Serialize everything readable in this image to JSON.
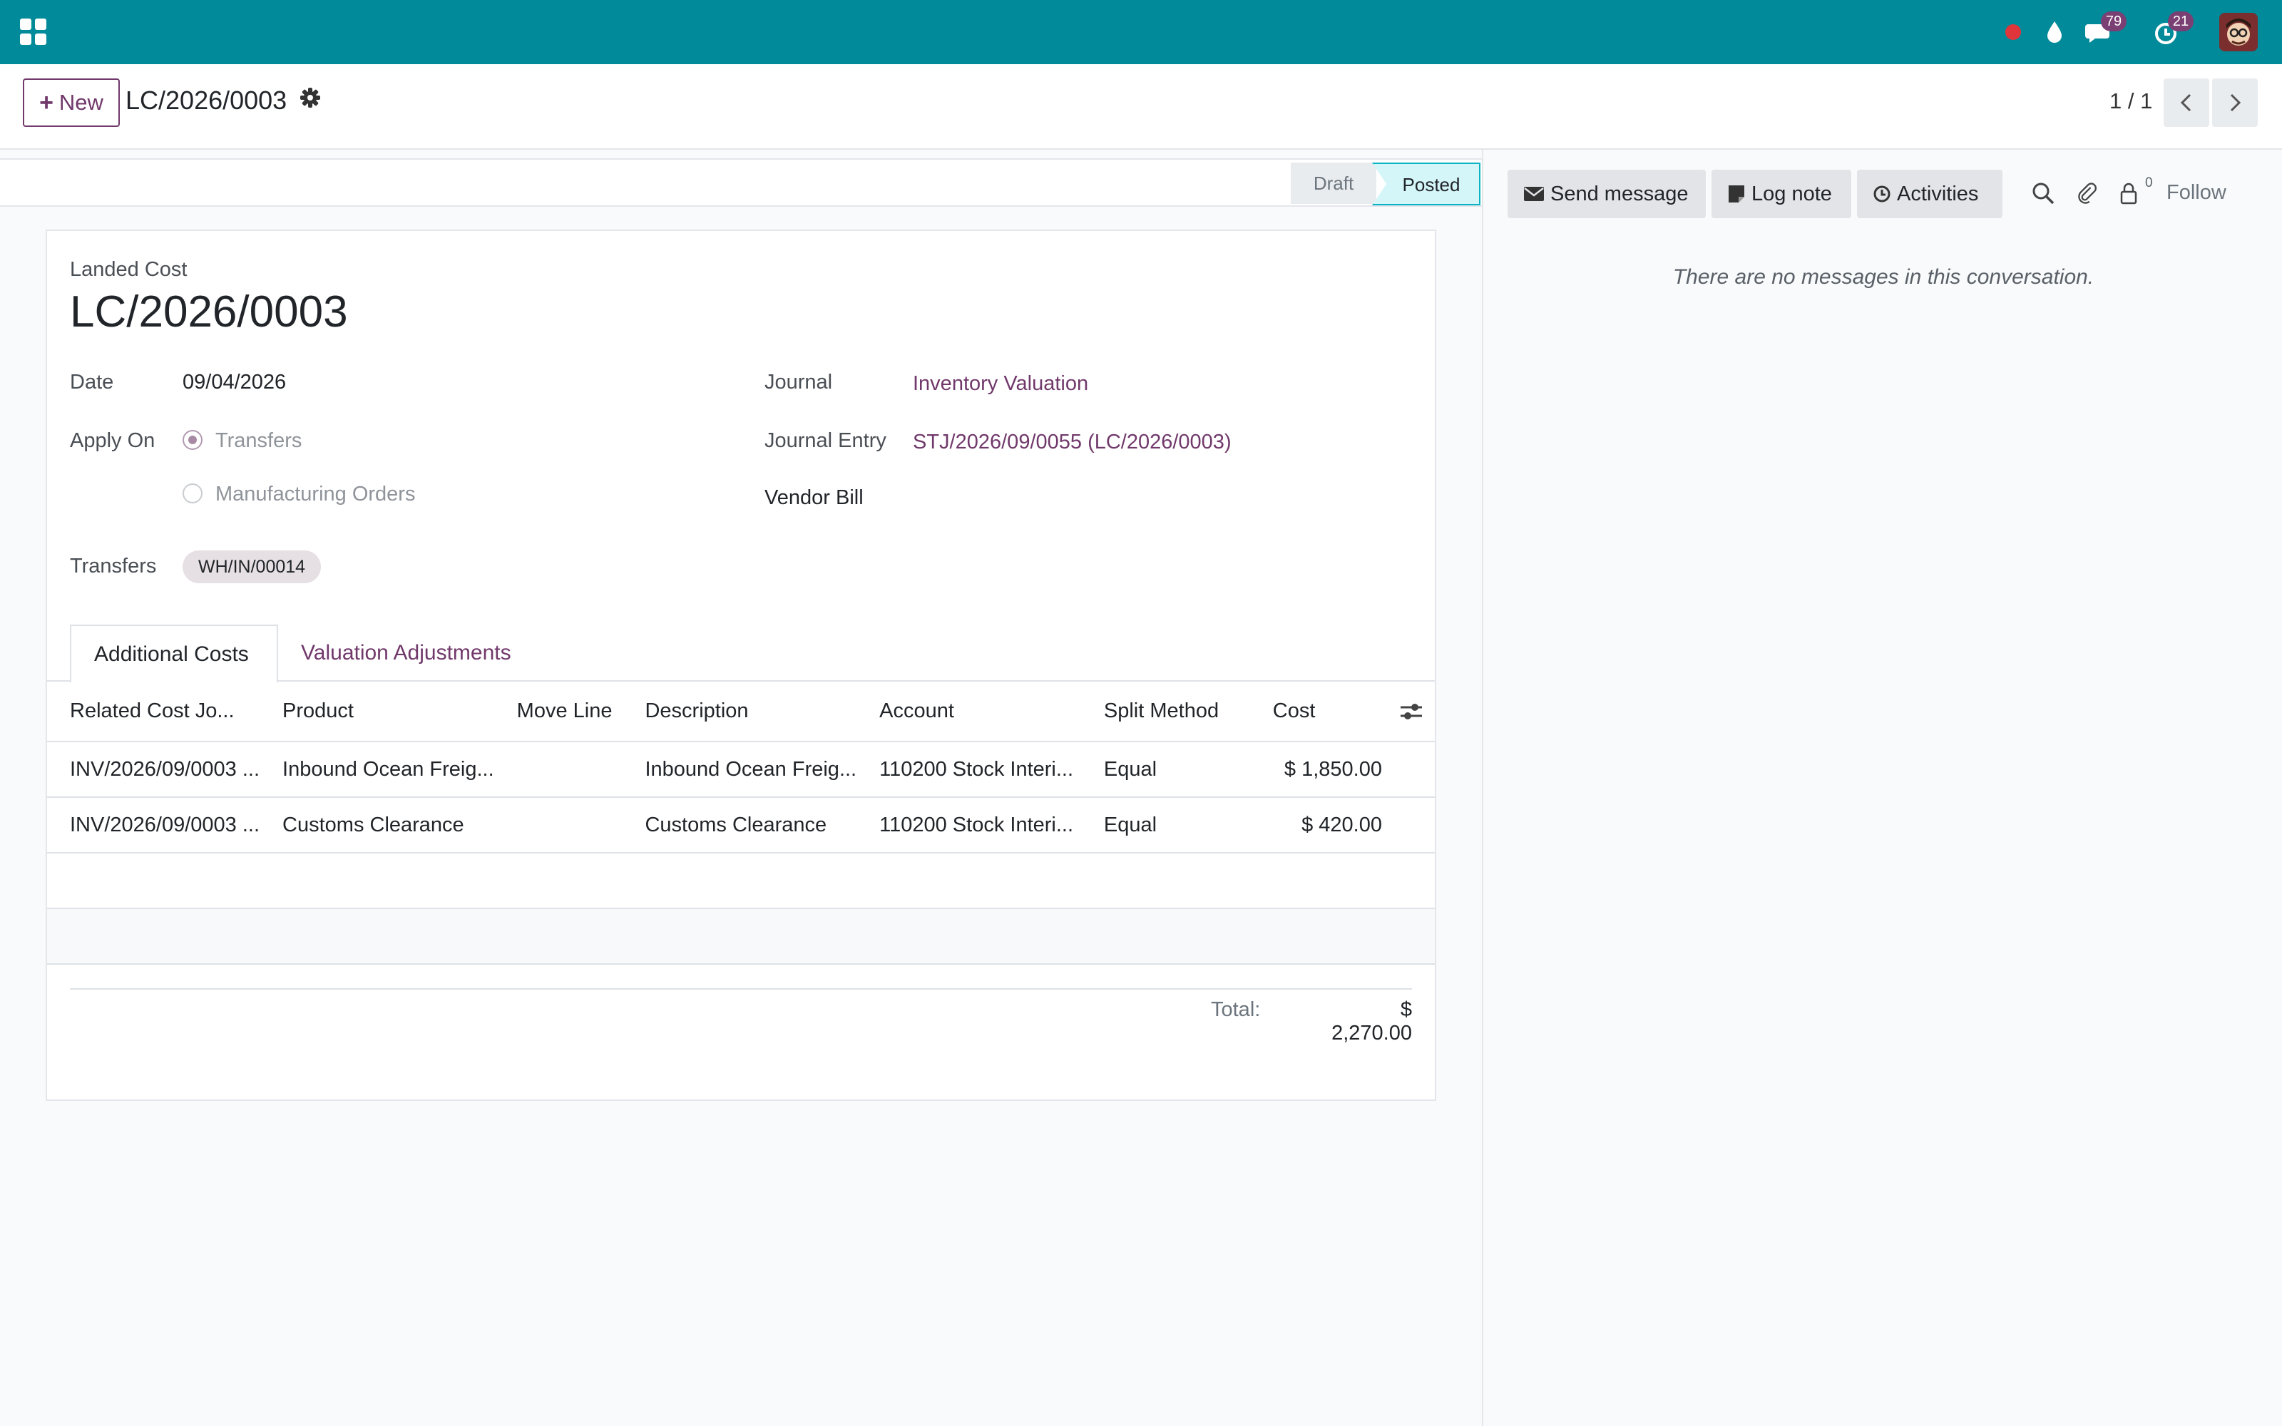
{
  "navbar": {
    "chat_badge": "79",
    "activity_badge": "21"
  },
  "control": {
    "new_label": "New",
    "breadcrumb": "LC/2026/0003",
    "pager": "1 / 1"
  },
  "status": {
    "stages": [
      "Draft",
      "Posted"
    ],
    "current": "Posted"
  },
  "form": {
    "title_label": "Landed Cost",
    "title": "LC/2026/0003",
    "date_label": "Date",
    "date": "09/04/2026",
    "apply_on_label": "Apply On",
    "apply_on_options": [
      "Transfers",
      "Manufacturing Orders"
    ],
    "apply_on_selected": "Transfers",
    "transfers_label": "Transfers",
    "transfers_tag": "WH/IN/00014",
    "journal_label": "Journal",
    "journal": "Inventory Valuation",
    "journal_entry_label": "Journal Entry",
    "journal_entry": "STJ/2026/09/0055 (LC/2026/0003)",
    "vendor_bill_label": "Vendor Bill"
  },
  "tabs": [
    "Additional Costs",
    "Valuation Adjustments"
  ],
  "table": {
    "headers": [
      "Related Cost Jo...",
      "Product",
      "Move Line",
      "Description",
      "Account",
      "Split Method",
      "Cost"
    ],
    "rows": [
      [
        "INV/2026/09/0003 ...",
        "Inbound Ocean Freig...",
        "",
        "Inbound Ocean Freig...",
        "110200 Stock Interi...",
        "Equal",
        "$ 1,850.00"
      ],
      [
        "INV/2026/09/0003 ...",
        "Customs Clearance",
        "",
        "Customs Clearance",
        "110200 Stock Interi...",
        "Equal",
        "$ 420.00"
      ]
    ],
    "total_label": "Total:",
    "total_value": "$ 2,270.00"
  },
  "chatter": {
    "send_message": "Send message",
    "log_note": "Log note",
    "activities": "Activities",
    "follower_count": "0",
    "follow": "Follow",
    "empty": "There are no messages in this conversation."
  },
  "colors": {
    "navbar": "#018a99",
    "brand": "#71396b",
    "posted": "#d5f6f9"
  }
}
